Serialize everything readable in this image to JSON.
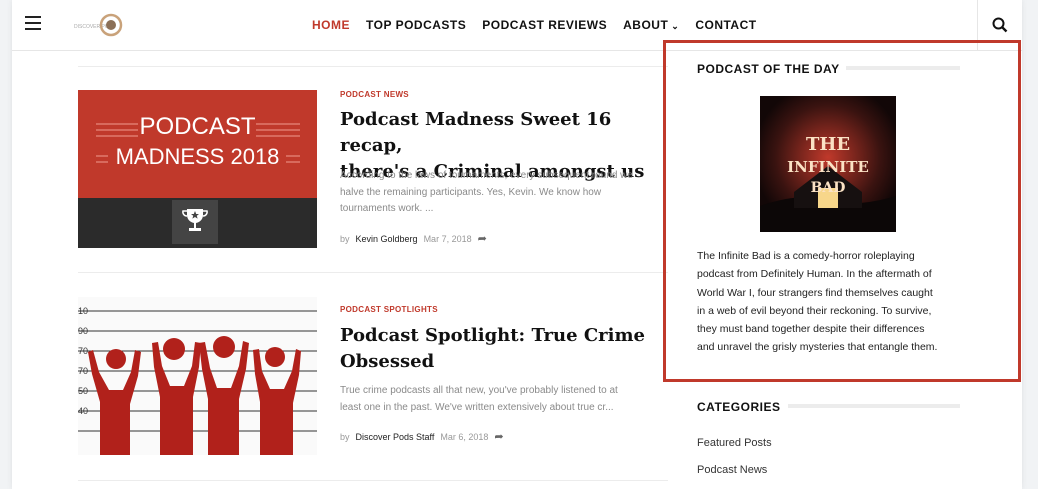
{
  "nav": {
    "items": [
      {
        "label": "HOME",
        "active": true
      },
      {
        "label": "TOP PODCASTS"
      },
      {
        "label": "PODCAST REVIEWS"
      },
      {
        "label": "ABOUT",
        "dropdown": true
      },
      {
        "label": "CONTACT"
      }
    ],
    "dropdown_icon": "⌄"
  },
  "articles": [
    {
      "category": "PODCAST NEWS",
      "title_line1": "Podcast Madness Sweet 16 recap,",
      "title_line2": "there's a Criminal amongst us",
      "excerpt_lines": [
        "According to the laws of tournaments, every subsequent round we",
        "halve the remaining participants. Yes, Kevin. We know how",
        "tournaments work. ..."
      ],
      "by": "by",
      "author": "Kevin Goldberg",
      "date": "Mar 7, 2018",
      "thumb_text_line1": "PODCAST",
      "thumb_text_line2": "MADNESS 2018"
    },
    {
      "category": "PODCAST SPOTLIGHTS",
      "title_line1": "Podcast Spotlight: True Crime",
      "title_line2": "Obsessed",
      "excerpt_lines": [
        "True crime podcasts all that new, you've probably listened to at",
        "least one in the past. We've written extensively about true cr..."
      ],
      "by": "by",
      "author": "Discover Pods Staff",
      "date": "Mar 6, 2018"
    }
  ],
  "sidebar": {
    "potd_title": "PODCAST OF THE DAY",
    "potd_cover_text_line1": "THE",
    "potd_cover_text_line2": "INFINITE",
    "potd_cover_text_line3": "BAD",
    "potd_description_lines": [
      "The Infinite Bad is a comedy-horror roleplaying",
      "podcast from Definitely Human. In the aftermath of",
      "World War I, four strangers find themselves caught",
      "in a web of evil beyond their reckoning. To survive,",
      "they must band together despite their differences",
      "and unravel the grisly mysteries that entangle them."
    ],
    "categories_title": "CATEGORIES",
    "categories": [
      "Featured Posts",
      "Podcast News"
    ]
  },
  "colors": {
    "accent": "#c0392b"
  }
}
